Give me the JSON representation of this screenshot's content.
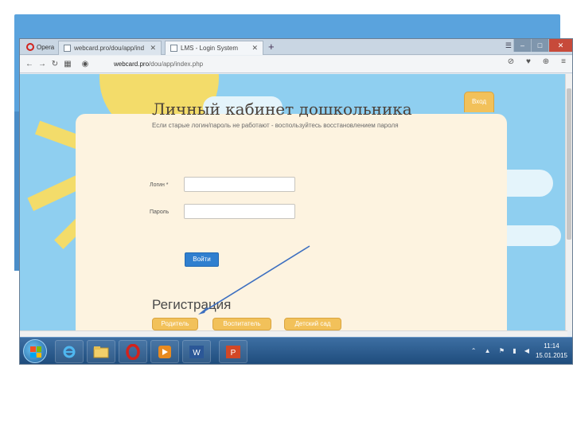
{
  "tabs": [
    {
      "label": "webcard.pro/dou/app/ind"
    },
    {
      "label": "LMS - Login System"
    }
  ],
  "opera_label": "Opera",
  "tab_close_glyph": "✕",
  "new_tab_glyph": "+",
  "address": {
    "url_host": "webcard.pro",
    "url_path": "/dou/app/index.php"
  },
  "page": {
    "login_tab": "Вход",
    "title": "Личный кабинет дошкольника",
    "subtitle": "Если старые логин/пароль не работают - воспользуйтесь восстановлением пароля",
    "login_label": "Логин *",
    "password_label": "Пароль",
    "submit_label": "Войти",
    "registration_title": "Регистрация",
    "registration_buttons": [
      "Родитель",
      "Воспитатель",
      "Детский сад"
    ]
  },
  "taskbar": {
    "time": "11:14",
    "date": "15.01.2015"
  },
  "colors": {
    "sky": "#8fcff0",
    "card": "#fdf3e0",
    "accent_yellow": "#f2c15a",
    "button_blue": "#2f7fcf",
    "taskbar": "#1d4a7a"
  },
  "icons": [
    "back-icon",
    "forward-icon",
    "reload-icon",
    "grid-icon",
    "site-lock-icon",
    "adblock-icon",
    "heart-icon",
    "download-icon",
    "menu-icon",
    "windows-start-icon",
    "ie-icon",
    "explorer-icon",
    "opera-icon",
    "media-icon",
    "word-icon",
    "powerpoint-icon"
  ]
}
